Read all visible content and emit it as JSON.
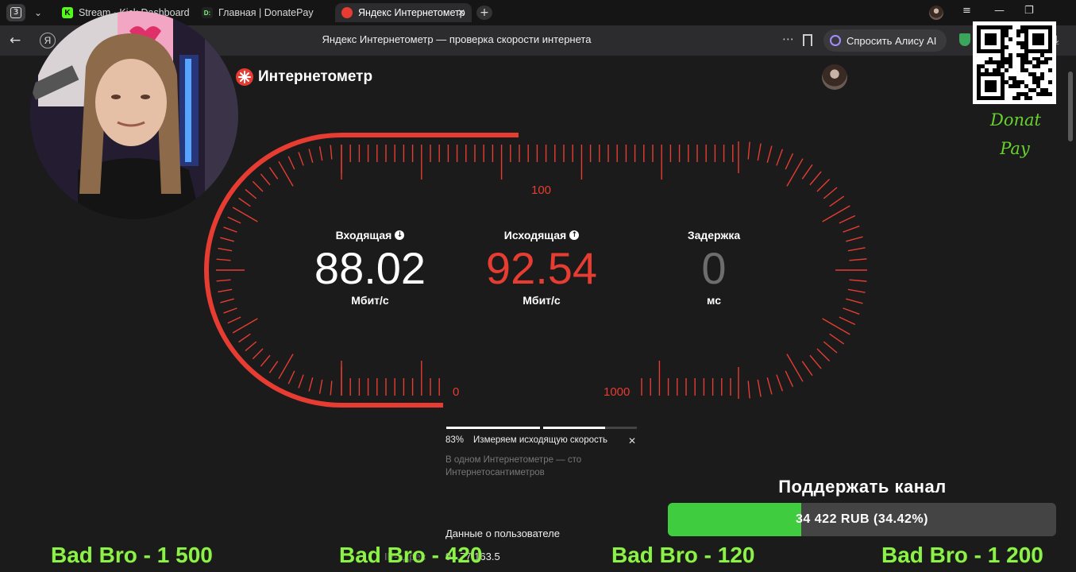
{
  "browser": {
    "tab_count": "3",
    "tabs": [
      {
        "label": "Stream · Kick Dashboard",
        "favicon": "K"
      },
      {
        "label": "Главная | DonatePay",
        "favicon": "D:"
      },
      {
        "label": "Яндекс Интернетометр",
        "favicon": "yandex-logo-icon"
      }
    ],
    "address_title": "Яндекс Интернетометр — проверка скорости интернета",
    "alice_button": "Спросить Алису AI",
    "ya_button": "Я"
  },
  "page": {
    "logo_text": "Интернетометр",
    "download": {
      "label": "Входящая",
      "value": "88.02",
      "unit": "Мбит/с"
    },
    "upload": {
      "label": "Исходящая",
      "value": "92.54",
      "unit": "Мбит/с"
    },
    "latency": {
      "label": "Задержка",
      "value": "0",
      "unit": "мс"
    },
    "scale_labels": {
      "top": "100",
      "left": "0",
      "right": "1000"
    },
    "progress": {
      "percent_text": "83%",
      "percent": 83,
      "status": "Измеряем исходящую скорость"
    },
    "hint": "В одном Интернетометре — сто Интернетосантиметров",
    "user_data_title": "Данные о пользователе",
    "ip_label": "IP-адрес",
    "ip_value": "94.77.163.5"
  },
  "overlay": {
    "donat_line1": "Donat",
    "donat_line2": "Pay",
    "support_title": "Поддержать канал",
    "support_amount": "34 422 RUB (34.42%)",
    "support_fraction": 0.3442,
    "ticker": [
      "Bad Bro - 1 500",
      "Bad Bro - 420",
      "Bad Bro - 120",
      "Bad Bro - 1 200"
    ]
  },
  "colors": {
    "accent": "#e63c32",
    "green": "#3fcc3f",
    "ticker": "#8ef04a"
  }
}
